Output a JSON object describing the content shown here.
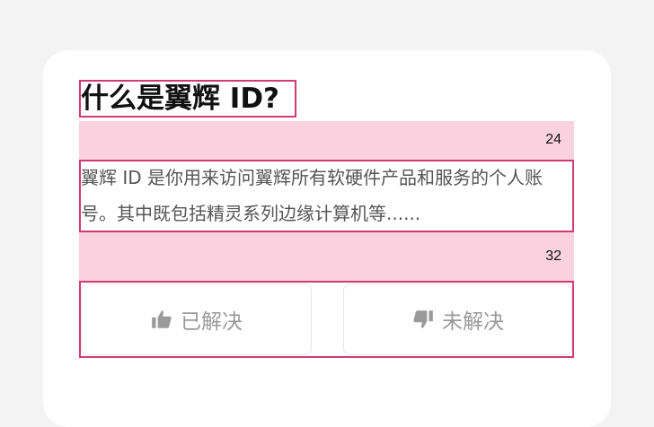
{
  "faq": {
    "title": "什么是翼辉 ID?",
    "description": "翼辉 ID 是你用来访问翼辉所有软硬件产品和服务的个人账号。其中既包括精灵系列边缘计算机等......",
    "spacer_top_value": "24",
    "spacer_bottom_value": "32"
  },
  "actions": {
    "solved_label": "已解决",
    "solved_icon": "thumbs-up-icon",
    "unsolved_label": "未解决",
    "unsolved_icon": "thumbs-down-icon"
  },
  "colors": {
    "highlight_border": "#d33a72",
    "spacer_fill": "#fad2df",
    "button_text": "#9a9a9a"
  }
}
